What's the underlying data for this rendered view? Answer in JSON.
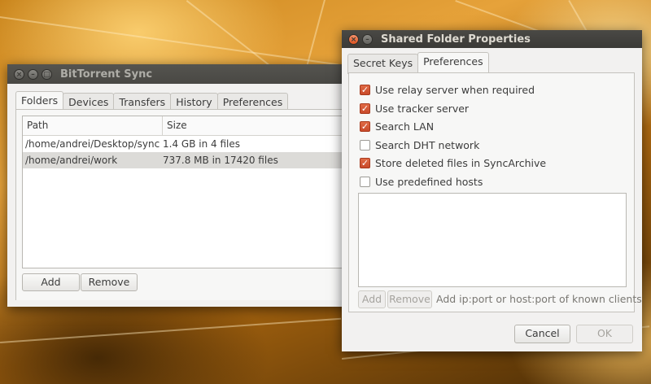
{
  "main_window": {
    "title": "BitTorrent Sync",
    "tabs": [
      "Folders",
      "Devices",
      "Transfers",
      "History",
      "Preferences"
    ],
    "columns": {
      "path": "Path",
      "size": "Size"
    },
    "rows": [
      {
        "path": "/home/andrei/Desktop/sync",
        "size": "1.4 GB in 4 files"
      },
      {
        "path": "/home/andrei/work",
        "size": "737.8 MB in 17420 files"
      }
    ],
    "add_label": "Add",
    "remove_label": "Remove"
  },
  "dialog": {
    "title": "Shared Folder Properties",
    "tabs": [
      "Secret Keys",
      "Preferences"
    ],
    "options": [
      {
        "label": "Use relay server when required",
        "checked": true
      },
      {
        "label": "Use tracker server",
        "checked": true
      },
      {
        "label": "Search LAN",
        "checked": true
      },
      {
        "label": "Search DHT network",
        "checked": false
      },
      {
        "label": "Store deleted files in SyncArchive",
        "checked": true
      },
      {
        "label": "Use predefined hosts",
        "checked": false
      }
    ],
    "hosts_add_label": "Add",
    "hosts_remove_label": "Remove",
    "hosts_hint": "Add ip:port or host:port of known clients",
    "cancel_label": "Cancel",
    "ok_label": "OK"
  },
  "colors": {
    "check_accent": "#d9572f",
    "titlebar": "#3c3b37",
    "selected_row": "#dcdbd8"
  }
}
